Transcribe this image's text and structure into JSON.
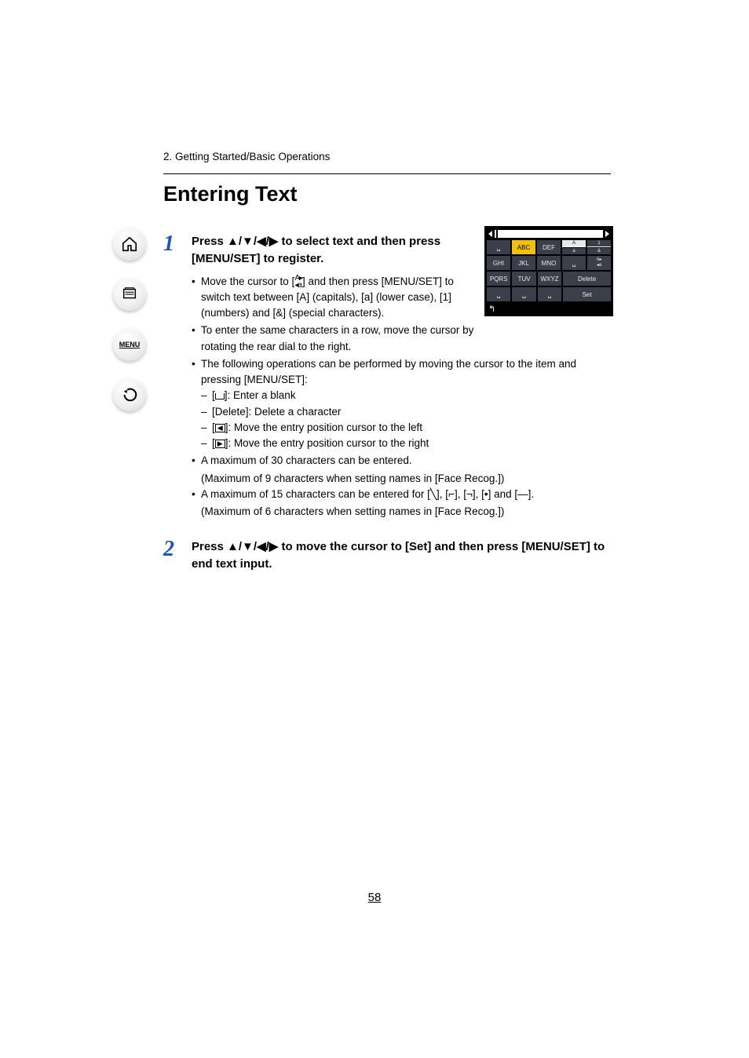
{
  "breadcrumb": "2. Getting Started/Basic Operations",
  "title": "Entering Text",
  "page_number": "58",
  "sidebar": {
    "home": "home-icon",
    "layers": "layers-icon",
    "menu_label": "MENU",
    "back": "back-icon"
  },
  "step1": {
    "number": "1",
    "heading_a": "Press ",
    "heading_arrows": "▲/▼/◀/▶",
    "heading_b": " to select text and then press [MENU/SET] to register.",
    "b1_a": "Move the cursor to [",
    "b1_icon_top": "A▸",
    "b1_icon_bot": "◂a",
    "b1_b": "] and then press [MENU/SET] to switch text between [A] (capitals), [a] (lower case), [1] (numbers) and [&] (special characters).",
    "b2": "To enter the same characters in a row, move the cursor by rotating the rear dial to the right.",
    "b3": "The following operations can be performed by moving the cursor to the item and pressing [MENU/SET]:",
    "sub1_a": "[",
    "sub1_icon": "␣",
    "sub1_b": "]: Enter a blank",
    "sub2": "[Delete]: Delete a character",
    "sub3_a": "[",
    "sub3_icon": "◀",
    "sub3_b": "]: Move the entry position cursor to the left",
    "sub4_a": "[",
    "sub4_icon": "▶",
    "sub4_b": "]: Move the entry position cursor to the right",
    "b4_line1": "A maximum of 30 characters can be entered.",
    "b4_line2": "(Maximum of 9 characters when setting names in [Face Recog.])",
    "b5_a": "A maximum of 15 characters can be entered for [",
    "b5_i1": "╲",
    "b5_mid1": "], [",
    "b5_i2": "⌐",
    "b5_mid2": "], [",
    "b5_i3": "⌐",
    "b5_mid3": "], [",
    "b5_i4": "•",
    "b5_mid4": "] and [",
    "b5_i5": "—",
    "b5_b": "].",
    "b5_line2": "(Maximum of 6 characters when setting names in [Face Recog.])"
  },
  "step2": {
    "number": "2",
    "heading_a": "Press ",
    "heading_arrows": "▲/▼/◀/▶",
    "heading_b": " to move the cursor to [Set] and then press [MENU/SET] to end text input."
  },
  "kbd": {
    "r1c1": "␣",
    "r1c2": "ABC",
    "r1c3": "DEF",
    "mode_A": "A",
    "mode_a": "a",
    "mode_1": "1",
    "mode_amp": "&",
    "r2c1": "GHI",
    "r2c2": "JKL",
    "r2c3": "MNO",
    "r2c4": "␣",
    "r2c5_top": "A▸",
    "r2c5_bot": "◂a",
    "r3c1": "PQRS",
    "r3c2": "TUV",
    "r3c3": "WXYZ",
    "r3c4": "Delete",
    "r4c1": "␣",
    "r4c2": "␣",
    "r4c3": "␣",
    "r4c4": "Set"
  }
}
